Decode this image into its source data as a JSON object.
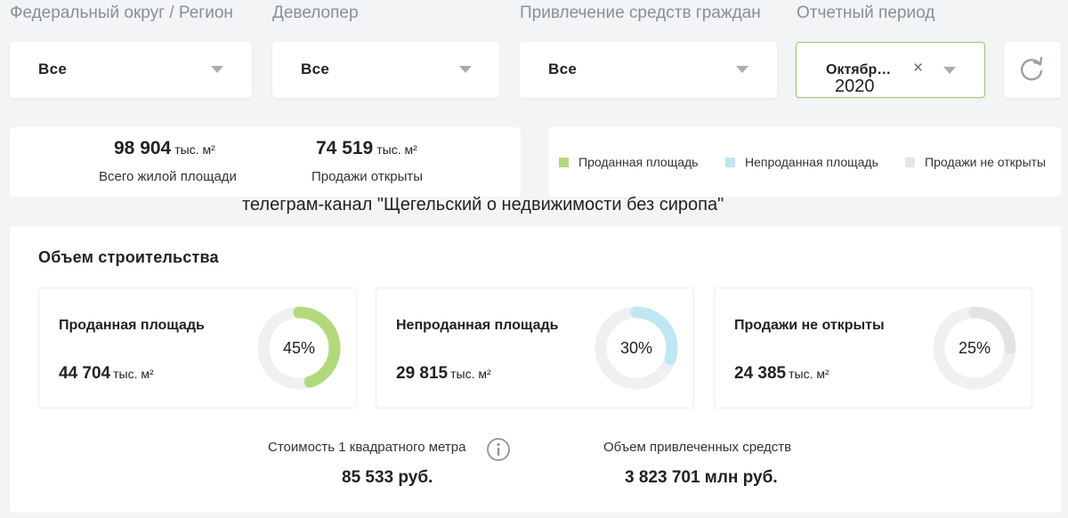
{
  "filters": {
    "region": {
      "label": "Федеральный округ / Регион",
      "value": "Все"
    },
    "developer": {
      "label": "Девелопер",
      "value": "Все"
    },
    "funding": {
      "label": "Привлечение средств граждан",
      "value": "Все"
    },
    "period": {
      "label": "Отчетный период",
      "value": "Октябр…",
      "year": "2020",
      "clear": "×"
    },
    "refresh_icon": "refresh-icon"
  },
  "summary": {
    "total": {
      "value": "98 904",
      "unit": "тыс. м²",
      "caption": "Всего жилой площади"
    },
    "open": {
      "value": "74 519",
      "unit": "тыс. м²",
      "caption": "Продажи открыты"
    }
  },
  "legend": [
    {
      "label": "Проданная площадь",
      "color": "#b3d97c"
    },
    {
      "label": "Непроданная площадь",
      "color": "#bfe6f3"
    },
    {
      "label": "Продажи не открыты",
      "color": "#e4e6e8"
    }
  ],
  "watermark": "телеграм-канал \"Щегельский о недвижимости без сиропа\"",
  "construction": {
    "title": "Объем строительства",
    "cards": [
      {
        "title": "Проданная площадь",
        "value": "44 704",
        "unit": "тыс. м²",
        "percent_label": "45%",
        "percent": 45,
        "color": "#b3d97c"
      },
      {
        "title": "Непроданная площадь",
        "value": "29 815",
        "unit": "тыс. м²",
        "percent_label": "30%",
        "percent": 30,
        "color": "#bfe6f3"
      },
      {
        "title": "Продажи не открыты",
        "value": "24 385",
        "unit": "тыс. м²",
        "percent_label": "25%",
        "percent": 25,
        "color": "#e1e3e5"
      }
    ]
  },
  "footer": {
    "price": {
      "caption": "Стоимость 1 квадратного метра",
      "value": "85 533 руб."
    },
    "funds": {
      "caption": "Объем привлеченных средств",
      "value": "3 823 701 млн руб."
    }
  }
}
